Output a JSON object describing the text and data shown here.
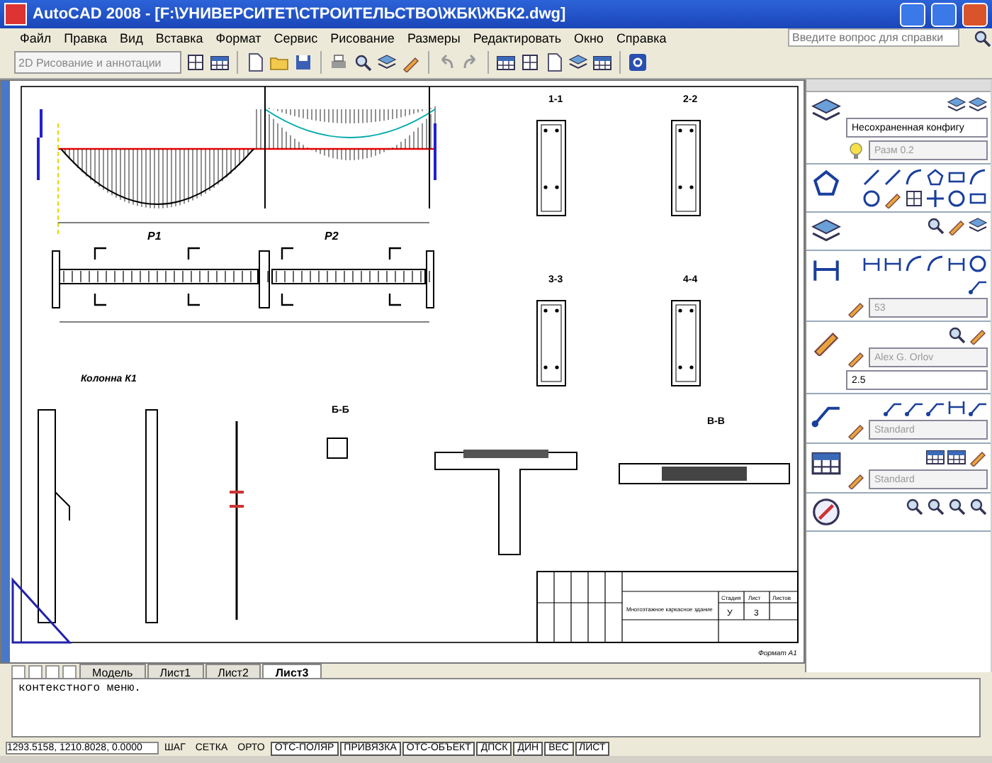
{
  "window": {
    "title": "AutoCAD 2008 - [F:\\УНИВЕРСИТЕТ\\СТРОИТЕЛЬСТВО\\ЖБК\\ЖБК2.dwg]"
  },
  "menu": [
    "Файл",
    "Правка",
    "Вид",
    "Вставка",
    "Формат",
    "Сервис",
    "Рисование",
    "Размеры",
    "Редактировать",
    "Окно",
    "Справка"
  ],
  "help_search": {
    "placeholder": "Введите вопрос для справки"
  },
  "workspace": {
    "value": "2D Рисование и аннотации"
  },
  "drawing": {
    "beam_labels": [
      "Р1",
      "Р2"
    ],
    "section_labels": [
      "1-1",
      "2-2",
      "3-3",
      "4-4"
    ],
    "column_title": "Колонна К1",
    "view_labels": [
      "Б-Б",
      "В-В"
    ],
    "title_block": {
      "building": "Многоэтажное каркасное здание",
      "stage_header": "Стадия",
      "sheet_header": "Лист",
      "sheets_header": "Листов",
      "stage": "У",
      "sheet": "3",
      "format": "Формат А1"
    }
  },
  "layout_tabs": [
    {
      "label": "Модель",
      "selected": false
    },
    {
      "label": "Лист1",
      "selected": false
    },
    {
      "label": "Лист2",
      "selected": false
    },
    {
      "label": "Лист3",
      "selected": true
    }
  ],
  "command_line": {
    "text": "контекстного меню."
  },
  "palette": {
    "sections": [
      {
        "kind": "layers",
        "fields": [
          {
            "value": "Несохраненная конфигу",
            "disabled": false
          },
          {
            "value": "Разм 0.2",
            "disabled": true
          }
        ]
      },
      {
        "kind": "draw"
      },
      {
        "kind": "modify"
      },
      {
        "kind": "dimension",
        "fields": [
          {
            "value": "53",
            "disabled": true
          }
        ]
      },
      {
        "kind": "text",
        "fields": [
          {
            "value": "Alex G. Orlov",
            "disabled": true
          },
          {
            "value": "2.5",
            "disabled": false
          }
        ]
      },
      {
        "kind": "leader",
        "fields": [
          {
            "value": "Standard",
            "disabled": true
          }
        ]
      },
      {
        "kind": "table",
        "fields": [
          {
            "value": "Standard",
            "disabled": true
          }
        ]
      },
      {
        "kind": "navigation"
      }
    ]
  },
  "status_bar": {
    "coordinates": "1293.5158, 1210.8028, 0.0000",
    "toggles": [
      {
        "label": "ШАГ",
        "on": false
      },
      {
        "label": "СЕТКА",
        "on": false
      },
      {
        "label": "ОРТО",
        "on": false
      },
      {
        "label": "ОТС-ПОЛЯР",
        "on": true
      },
      {
        "label": "ПРИВЯЗКА",
        "on": true
      },
      {
        "label": "ОТС-ОБЪЕКТ",
        "on": true
      },
      {
        "label": "ДПСК",
        "on": true
      },
      {
        "label": "ДИН",
        "on": true
      },
      {
        "label": "ВЕС",
        "on": true
      },
      {
        "label": "ЛИСТ",
        "on": true
      }
    ]
  }
}
